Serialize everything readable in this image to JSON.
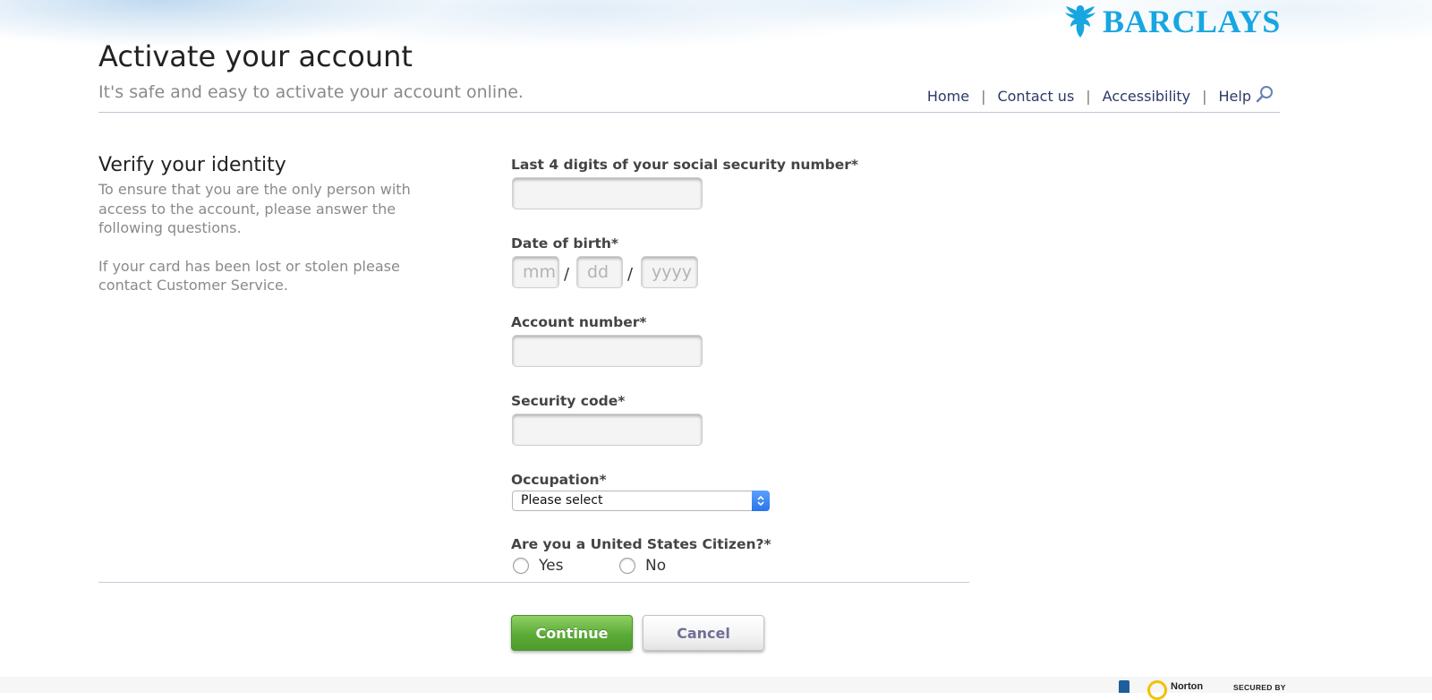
{
  "brand": {
    "name": "BARCLAYS",
    "color": "#19a6e0",
    "icon": "eagle-icon"
  },
  "header": {
    "title": "Activate your account",
    "subtitle": "It's safe and easy to activate your account online.",
    "nav": {
      "home": "Home",
      "contact": "Contact us",
      "accessibility": "Accessibility",
      "help": "Help",
      "separator": "|"
    }
  },
  "intro": {
    "heading": "Verify your identity",
    "paragraph1": "To ensure that you are the only person with access to the account, please answer the following questions.",
    "paragraph2": "If your card has been lost or stolen please contact Customer Service."
  },
  "form": {
    "ssn": {
      "label": "Last 4 digits of your social security number*",
      "value": ""
    },
    "dob": {
      "label": "Date of birth*",
      "month_placeholder": "mm",
      "day_placeholder": "dd",
      "year_placeholder": "yyyy",
      "separator": "/"
    },
    "account": {
      "label": "Account number*",
      "value": ""
    },
    "security_code": {
      "label": "Security code*",
      "value": ""
    },
    "occupation": {
      "label": "Occupation*",
      "selected": "Please select"
    },
    "citizen": {
      "label": "Are you a United States Citizen?*",
      "yes": "Yes",
      "no": "No"
    }
  },
  "buttons": {
    "continue": "Continue",
    "cancel": "Cancel"
  },
  "footer": {
    "secured_by": "SECURED BY",
    "norton": "Norton"
  }
}
